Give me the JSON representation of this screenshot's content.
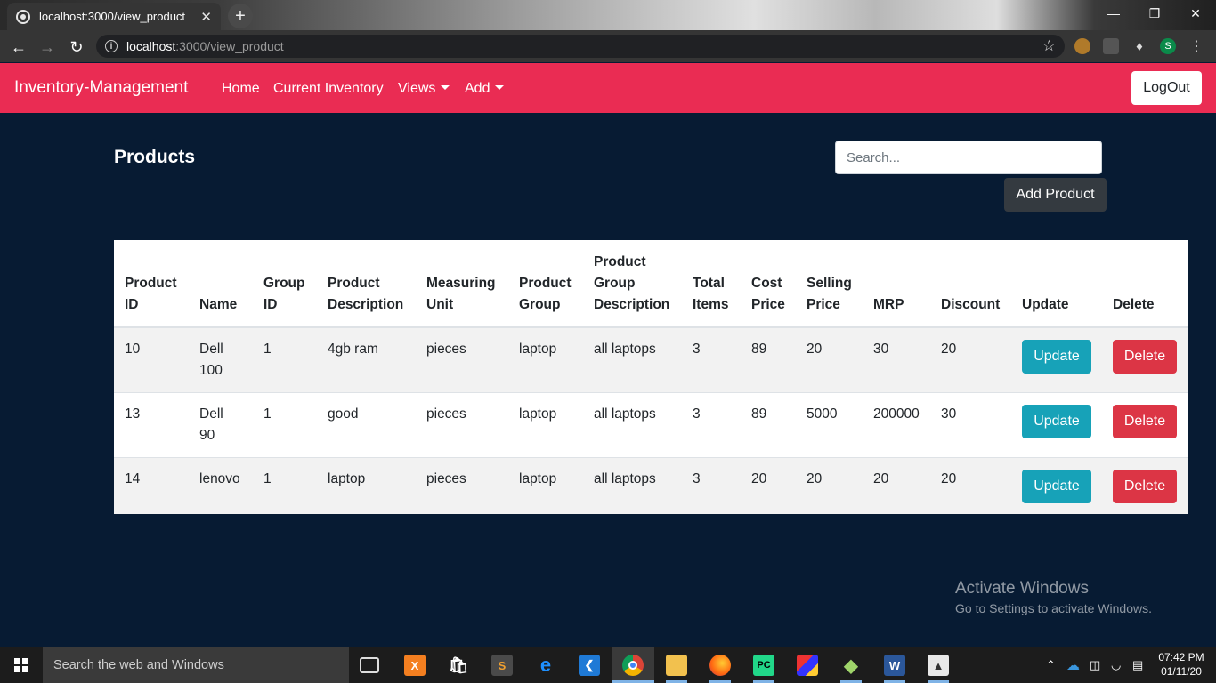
{
  "browser": {
    "tab_title": "localhost:3000/view_product",
    "url_host": "localhost",
    "url_rest": ":3000/view_product",
    "profile_initial": "S"
  },
  "navbar": {
    "brand": "Inventory-Management",
    "links": [
      "Home",
      "Current Inventory",
      "Views",
      "Add"
    ],
    "logout": "LogOut",
    "accent_color": "#ea2c53"
  },
  "page": {
    "title": "Products",
    "search_placeholder": "Search...",
    "add_button": "Add Product",
    "background_color": "#071b33"
  },
  "table": {
    "headers": [
      "Product ID",
      "Name",
      "Group ID",
      "Product Description",
      "Measuring Unit",
      "Product Group",
      "Product Group Description",
      "Total Items",
      "Cost Price",
      "Selling Price",
      "MRP",
      "Discount",
      "Update",
      "Delete"
    ],
    "rows": [
      {
        "id": "10",
        "name": "Dell 100",
        "group_id": "1",
        "description": "4gb ram",
        "unit": "pieces",
        "group": "laptop",
        "group_desc": "all laptops",
        "total": "3",
        "cost": "89",
        "selling": "20",
        "mrp": "30",
        "discount": "20"
      },
      {
        "id": "13",
        "name": "Dell 90",
        "group_id": "1",
        "description": "good",
        "unit": "pieces",
        "group": "laptop",
        "group_desc": "all laptops",
        "total": "3",
        "cost": "89",
        "selling": "5000",
        "mrp": "200000",
        "discount": "30"
      },
      {
        "id": "14",
        "name": "lenovo",
        "group_id": "1",
        "description": "laptop",
        "unit": "pieces",
        "group": "laptop",
        "group_desc": "all laptops",
        "total": "3",
        "cost": "20",
        "selling": "20",
        "mrp": "20",
        "discount": "20"
      }
    ],
    "update_label": "Update",
    "delete_label": "Delete"
  },
  "watermark": {
    "line1": "Activate Windows",
    "line2": "Go to Settings to activate Windows."
  },
  "taskbar": {
    "search_text": "Search the web and Windows",
    "time": "07:42 PM",
    "date": "01/11/20",
    "apps": [
      "task-view",
      "xampp",
      "store",
      "sublime",
      "edge",
      "vscode",
      "chrome",
      "file-explorer",
      "firefox",
      "pycharm",
      "app",
      "git",
      "word",
      "photos"
    ]
  }
}
